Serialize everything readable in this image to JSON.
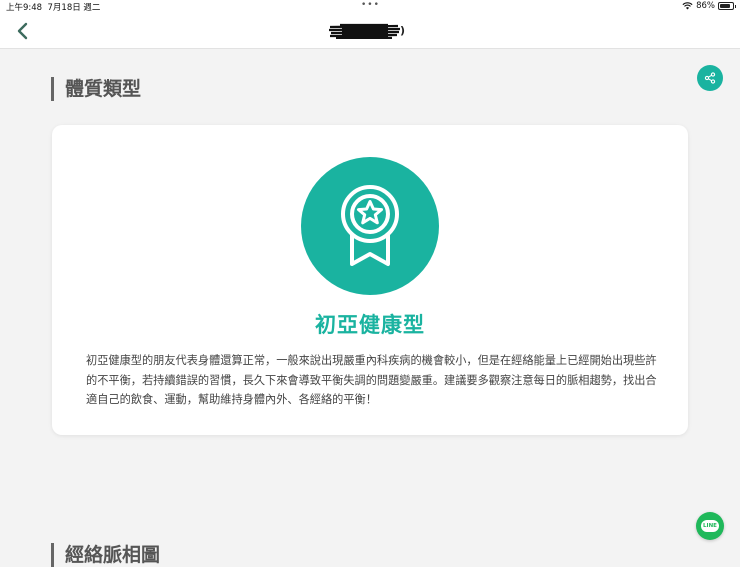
{
  "status_bar": {
    "time": "上午9:48",
    "date": "7月18日 週二",
    "battery_percent": "86%",
    "battery_level": 0.86
  },
  "nav": {
    "title_suffix": ")"
  },
  "section_constitution": {
    "title": "體質類型"
  },
  "card": {
    "type_name": "初亞健康型",
    "description": "初亞健康型的朋友代表身體還算正常，一般來說出現嚴重內科疾病的機會較小，但是在經絡能量上已經開始出現些許的不平衡，若持續錯誤的習慣，長久下來會導致平衡失調的問題變嚴重。建議要多觀察注意每日的脈相趨勢，找出合適自己的飲食、運動，幫助維持身體內外、各經絡的平衡！"
  },
  "section_pulse": {
    "title": "經絡脈相圖"
  },
  "line_button": {
    "label": "LINE"
  },
  "icons": {
    "back": "chevron-left-icon",
    "share": "share-icon",
    "badge": "award-star-icon",
    "line": "line-chat-icon"
  },
  "colors": {
    "accent": "#1ab3a0",
    "line_green": "#1fb85a"
  }
}
